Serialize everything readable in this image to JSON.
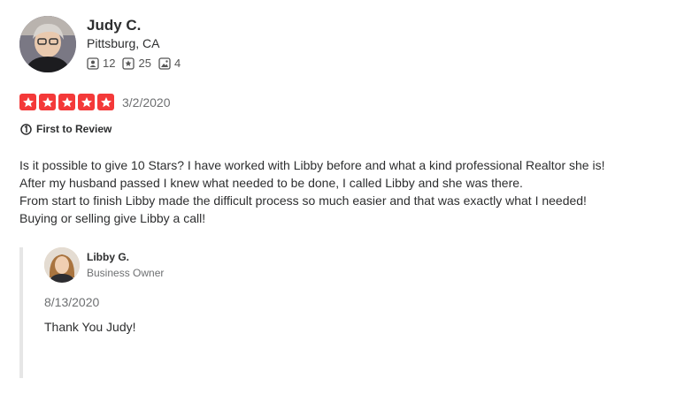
{
  "reviewer": {
    "name": "Judy C.",
    "location": "Pittsburg, CA",
    "friends": "12",
    "reviews": "25",
    "photos": "4"
  },
  "review": {
    "rating": 5,
    "max_rating": 5,
    "date": "3/2/2020",
    "badge": "First to Review",
    "lines": [
      "Is it possible to give 10 Stars? I have worked with Libby before and what a kind professional Realtor she is!",
      "After my husband passed I knew what needed to be done, I called Libby and she was there.",
      "From start to finish Libby made the difficult process so much easier and that was exactly what I needed!",
      "Buying or selling give Libby a call!"
    ]
  },
  "reply": {
    "owner_name": "Libby G.",
    "owner_role": "Business Owner",
    "date": "8/13/2020",
    "text": "Thank You Judy!"
  },
  "colors": {
    "star": "#f43939",
    "text": "#2d2e2f",
    "muted": "#6e7072",
    "reply_border": "#e6e6e6"
  },
  "icons": {
    "friends": "friends-icon",
    "reviews": "review-star-icon",
    "photos": "photo-icon",
    "badge": "first-to-review-icon",
    "star": "star-icon"
  }
}
